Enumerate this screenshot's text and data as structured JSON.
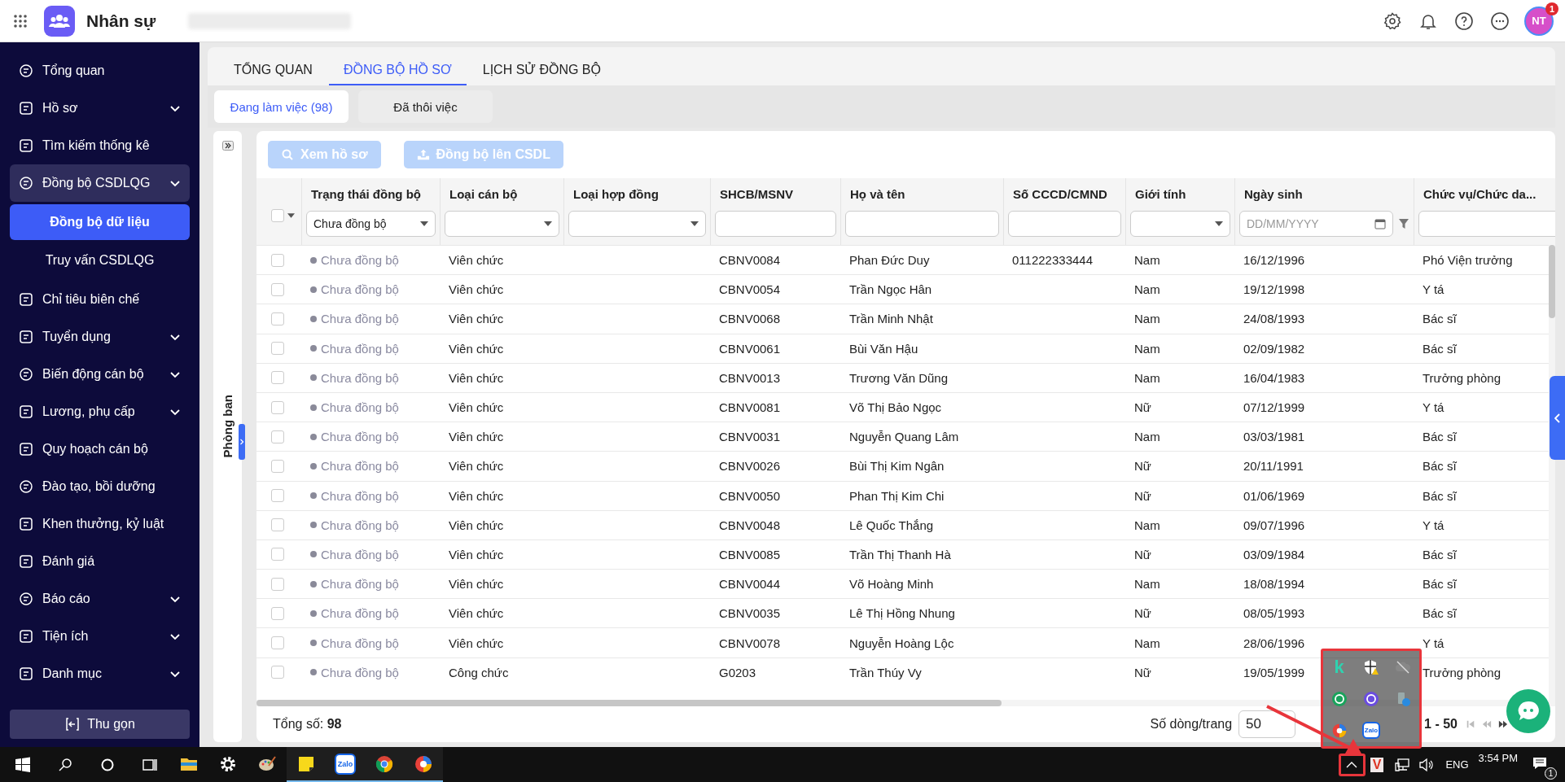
{
  "app": {
    "title": "Nhân sự"
  },
  "header": {
    "avatar": "NT",
    "badge": "1"
  },
  "sidebar": {
    "items": [
      {
        "label": "Tổng quan",
        "chevron": false,
        "active": false
      },
      {
        "label": "Hồ sơ",
        "chevron": true,
        "active": false
      },
      {
        "label": "Tìm kiếm thống kê",
        "chevron": false,
        "active": false
      },
      {
        "label": "Đồng bộ CSDLQG",
        "chevron": true,
        "active": true,
        "children": [
          {
            "label": "Đồng bộ dữ liệu",
            "selected": true
          },
          {
            "label": "Truy vấn CSDLQG",
            "selected": false
          }
        ]
      },
      {
        "label": "Chỉ tiêu biên chế",
        "chevron": false,
        "active": false
      },
      {
        "label": "Tuyển dụng",
        "chevron": true,
        "active": false
      },
      {
        "label": "Biến động cán bộ",
        "chevron": true,
        "active": false
      },
      {
        "label": "Lương, phụ cấp",
        "chevron": true,
        "active": false
      },
      {
        "label": "Quy hoạch cán bộ",
        "chevron": false,
        "active": false
      },
      {
        "label": "Đào tạo, bồi dưỡng",
        "chevron": false,
        "active": false
      },
      {
        "label": "Khen thưởng, kỷ luật",
        "chevron": false,
        "active": false
      },
      {
        "label": "Đánh giá",
        "chevron": false,
        "active": false
      },
      {
        "label": "Báo cáo",
        "chevron": true,
        "active": false
      },
      {
        "label": "Tiện ích",
        "chevron": true,
        "active": false
      },
      {
        "label": "Danh mục",
        "chevron": true,
        "active": false
      }
    ],
    "collapse_button": "Thu gọn"
  },
  "tabs": [
    {
      "label": "TỔNG QUAN",
      "selected": false
    },
    {
      "label": "ĐỒNG BỘ HỒ SƠ",
      "selected": true
    },
    {
      "label": "LỊCH SỬ ĐỒNG BỘ",
      "selected": false
    }
  ],
  "subtabs": [
    {
      "label": "Đang làm việc (98)",
      "selected": true
    },
    {
      "label": "Đã thôi việc",
      "selected": false
    }
  ],
  "side_panel": {
    "label": "Phòng ban"
  },
  "toolbar": [
    {
      "label": "Xem hồ sơ",
      "disabled": true
    },
    {
      "label": "Đồng bộ lên CSDL",
      "disabled": true
    }
  ],
  "table": {
    "select_all_checked": false,
    "columns": [
      {
        "label": "Trạng thái đồng bộ",
        "filter": {
          "kind": "select",
          "value": "Chưa đồng bộ"
        }
      },
      {
        "label": "Loại cán bộ",
        "filter": {
          "kind": "select"
        }
      },
      {
        "label": "Loại hợp đồng",
        "filter": {
          "kind": "select"
        }
      },
      {
        "label": "SHCB/MSNV",
        "filter": {
          "kind": "text"
        }
      },
      {
        "label": "Họ và tên",
        "filter": {
          "kind": "text"
        }
      },
      {
        "label": "Số CCCD/CMND",
        "filter": {
          "kind": "text"
        }
      },
      {
        "label": "Giới tính",
        "filter": {
          "kind": "select"
        }
      },
      {
        "label": "Ngày sinh",
        "filter": {
          "kind": "date",
          "placeholder": "DD/MM/YYYY"
        }
      },
      {
        "label": "Chức vụ/Chức da...",
        "filter": {
          "kind": "text"
        }
      }
    ],
    "rows": [
      {
        "checked": false,
        "cells": [
          "Chưa đồng bộ",
          "Viên chức",
          "",
          "CBNV0084",
          "Phan Đức Duy",
          "011222333444",
          "Nam",
          "16/12/1996",
          "Phó Viện trưởng"
        ]
      },
      {
        "checked": false,
        "cells": [
          "Chưa đồng bộ",
          "Viên chức",
          "",
          "CBNV0054",
          "Trần Ngọc Hân",
          "",
          "Nam",
          "19/12/1998",
          "Y tá"
        ]
      },
      {
        "checked": false,
        "cells": [
          "Chưa đồng bộ",
          "Viên chức",
          "",
          "CBNV0068",
          "Trần Minh Nhật",
          "",
          "Nam",
          "24/08/1993",
          "Bác sĩ"
        ]
      },
      {
        "checked": false,
        "cells": [
          "Chưa đồng bộ",
          "Viên chức",
          "",
          "CBNV0061",
          "Bùi Văn Hậu",
          "",
          "Nam",
          "02/09/1982",
          "Bác sĩ"
        ]
      },
      {
        "checked": false,
        "cells": [
          "Chưa đồng bộ",
          "Viên chức",
          "",
          "CBNV0013",
          "Trương Văn Dũng",
          "",
          "Nam",
          "16/04/1983",
          "Trưởng phòng"
        ]
      },
      {
        "checked": false,
        "cells": [
          "Chưa đồng bộ",
          "Viên chức",
          "",
          "CBNV0081",
          "Võ Thị Bảo Ngọc",
          "",
          "Nữ",
          "07/12/1999",
          "Y tá"
        ]
      },
      {
        "checked": false,
        "cells": [
          "Chưa đồng bộ",
          "Viên chức",
          "",
          "CBNV0031",
          "Nguyễn Quang Lâm",
          "",
          "Nam",
          "03/03/1981",
          "Bác sĩ"
        ]
      },
      {
        "checked": false,
        "cells": [
          "Chưa đồng bộ",
          "Viên chức",
          "",
          "CBNV0026",
          "Bùi Thị Kim Ngân",
          "",
          "Nữ",
          "20/11/1991",
          "Bác sĩ"
        ]
      },
      {
        "checked": false,
        "cells": [
          "Chưa đồng bộ",
          "Viên chức",
          "",
          "CBNV0050",
          "Phan Thị Kim Chi",
          "",
          "Nữ",
          "01/06/1969",
          "Bác sĩ"
        ]
      },
      {
        "checked": false,
        "cells": [
          "Chưa đồng bộ",
          "Viên chức",
          "",
          "CBNV0048",
          "Lê Quốc Thắng",
          "",
          "Nam",
          "09/07/1996",
          "Y tá"
        ]
      },
      {
        "checked": false,
        "cells": [
          "Chưa đồng bộ",
          "Viên chức",
          "",
          "CBNV0085",
          "Trần Thị Thanh Hà",
          "",
          "Nữ",
          "03/09/1984",
          "Bác sĩ"
        ]
      },
      {
        "checked": false,
        "cells": [
          "Chưa đồng bộ",
          "Viên chức",
          "",
          "CBNV0044",
          "Võ Hoàng Minh",
          "",
          "Nam",
          "18/08/1994",
          "Bác sĩ"
        ]
      },
      {
        "checked": false,
        "cells": [
          "Chưa đồng bộ",
          "Viên chức",
          "",
          "CBNV0035",
          "Lê Thị Hồng Nhung",
          "",
          "Nữ",
          "08/05/1993",
          "Bác sĩ"
        ]
      },
      {
        "checked": false,
        "cells": [
          "Chưa đồng bộ",
          "Viên chức",
          "",
          "CBNV0078",
          "Nguyễn Hoàng Lộc",
          "",
          "Nam",
          "28/06/1996",
          "Y tá"
        ]
      },
      {
        "checked": false,
        "cells": [
          "Chưa đồng bộ",
          "Công chức",
          "",
          "G0203",
          "Trần Thúy Vy",
          "",
          "Nữ",
          "19/05/1999",
          "Trưởng phòng"
        ]
      }
    ]
  },
  "footer": {
    "total": "Tổng số: **98**",
    "rows_per_page_label": "Số dòng/trang",
    "rows_per_page": "50",
    "range": "1 - 50"
  },
  "taskbar": {
    "apps": [
      {
        "kind": "explorer",
        "running": false
      },
      {
        "kind": "settings",
        "running": false
      },
      {
        "kind": "paint",
        "running": false
      },
      {
        "kind": "notes",
        "running": true
      },
      {
        "kind": "zalo",
        "running": true,
        "label": "Zalo"
      },
      {
        "kind": "chrome",
        "running": true
      },
      {
        "kind": "edge",
        "running": true
      }
    ],
    "tray_popup": [
      {
        "kind": "k",
        "label": "k"
      },
      {
        "kind": "shield"
      },
      {
        "kind": "cloud"
      },
      {
        "kind": "sync"
      },
      {
        "kind": "purple"
      },
      {
        "kind": "usb"
      },
      {
        "kind": "edge"
      },
      {
        "kind": "zalo",
        "label": "Zalo"
      }
    ],
    "tray": {
      "v": "V",
      "language": "ENG",
      "time": "3:54 PM",
      "notifications": "1"
    }
  }
}
